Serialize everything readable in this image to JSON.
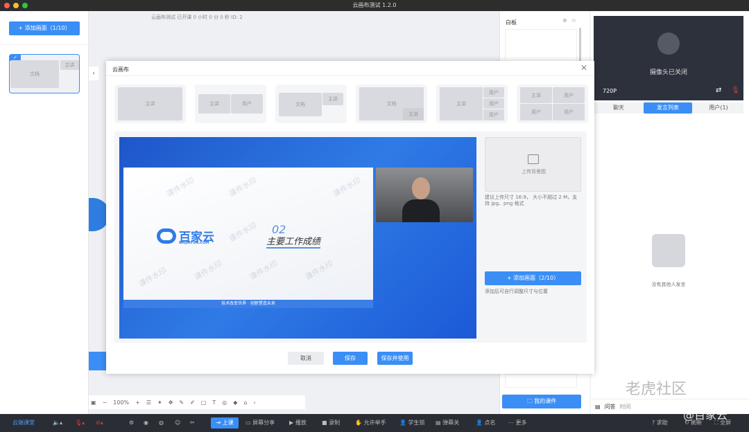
{
  "window": {
    "title": "云画布测试 1.2.0"
  },
  "class_info": "云画布测试   已开课 0 小时 0 分 0 秒   ID: 2",
  "sidebar": {
    "add_button": "+ 添加画面（1/10）",
    "thumb": {
      "main": "文档",
      "sub": "主讲"
    }
  },
  "whiteboard": {
    "title": "白板",
    "courseware_button": "我的课件"
  },
  "board_toolbar": {
    "zoom": "100%"
  },
  "camera": {
    "status": "摄像头已关闭",
    "resolution": "720P"
  },
  "right_tabs": [
    {
      "label": "聊天"
    },
    {
      "label": "发言列表",
      "active": true
    },
    {
      "label": "用户(1)"
    }
  ],
  "speak_empty": "没有其他人发言",
  "qa": {
    "label": "问答",
    "sort": "时间"
  },
  "modal": {
    "title": "云画布",
    "layouts": [
      {
        "blocks": [
          "主讲"
        ]
      },
      {
        "blocks": [
          "主讲",
          "用户"
        ]
      },
      {
        "blocks": [
          "文档",
          "主讲"
        ]
      },
      {
        "blocks": [
          "文档",
          "主讲"
        ]
      },
      {
        "blocks": [
          "主讲",
          "用户",
          "用户",
          "用户"
        ]
      },
      {
        "blocks": [
          "主讲",
          "用户",
          "用户",
          "用户"
        ]
      }
    ],
    "slide": {
      "logo": "百家云",
      "logo_sub": "BAIJIAYUN.COM",
      "number": "02",
      "heading": "主要工作成绩",
      "footer": "技术改变世界 · 创新塑造未来",
      "watermark": "课件水印"
    },
    "upload_bg": "上传背景图",
    "upload_hint": "建议上传尺寸 16:9， 大小不超过 2 M，支持 jpg、png 格式",
    "add_scene": "+ 添加画面（2/10）",
    "add_hint": "添加后可自行调整尺寸与位置",
    "cancel": "取消",
    "save": "保存",
    "save_use": "保存并使用"
  },
  "bottombar": {
    "brand": "云端课堂",
    "start": "上课",
    "items": [
      "屏幕分享",
      "播放",
      "录制",
      "允许举手",
      "学生锁",
      "弹幕关",
      "点名",
      "更多"
    ],
    "right": [
      "求助",
      "刷新",
      "全屏"
    ]
  },
  "overlay_watermark": {
    "community": "老虎社区",
    "brand": "@百家云"
  },
  "colors": {
    "accent": "#3a8ef6",
    "dark": "#2a2d34",
    "danger": "#e0393e"
  }
}
